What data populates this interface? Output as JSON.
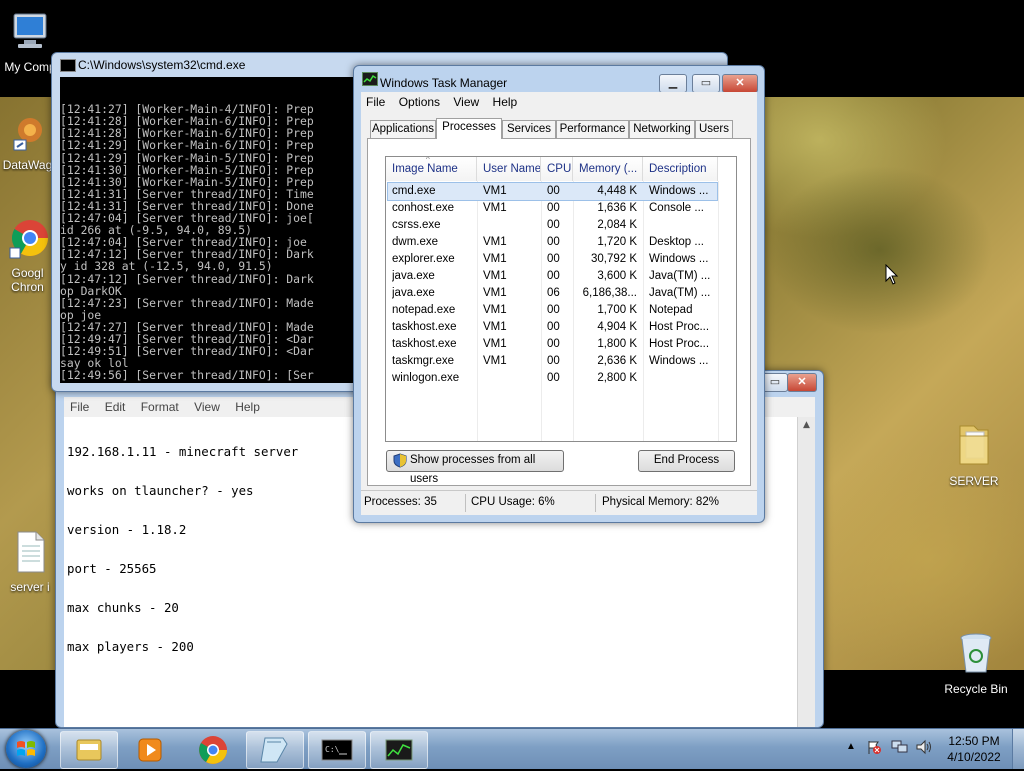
{
  "desktop": {
    "icons": {
      "my_computer": "My Comp",
      "datawag": "DataWag",
      "chrome_line1": "Googl",
      "chrome_line2": "Chron",
      "server_file": "server i",
      "server_folder": "SERVER",
      "recycle_bin": "Recycle Bin"
    }
  },
  "cmd": {
    "title": "C:\\Windows\\system32\\cmd.exe",
    "lines": [
      "[12:41:27] [Worker-Main-4/INFO]: Prep",
      "[12:41:28] [Worker-Main-6/INFO]: Prep",
      "[12:41:28] [Worker-Main-6/INFO]: Prep",
      "[12:41:29] [Worker-Main-6/INFO]: Prep",
      "[12:41:29] [Worker-Main-5/INFO]: Prep",
      "[12:41:30] [Worker-Main-5/INFO]: Prep",
      "[12:41:30] [Worker-Main-5/INFO]: Prep",
      "[12:41:31] [Server thread/INFO]: Time",
      "[12:41:31] [Server thread/INFO]: Done",
      "[12:47:04] [Server thread/INFO]: joe[",
      "id 266 at (-9.5, 94.0, 89.5)",
      "[12:47:04] [Server thread/INFO]: joe ",
      "[12:47:12] [Server thread/INFO]: Dark",
      "y id 328 at (-12.5, 94.0, 91.5)",
      "[12:47:12] [Server thread/INFO]: Dark",
      "op DarkOK",
      "[12:47:23] [Server thread/INFO]: Made",
      "op joe",
      "[12:47:27] [Server thread/INFO]: Made",
      "[12:49:47] [Server thread/INFO]: <Dar",
      "[12:49:51] [Server thread/INFO]: <Dar",
      "say ok lol",
      "[12:49:56] [Server thread/INFO]: [Ser"
    ]
  },
  "notepad": {
    "menu": [
      "File",
      "Edit",
      "Format",
      "View",
      "Help"
    ],
    "lines": [
      "192.168.1.11 - minecraft server",
      "works on tlauncher? - yes",
      "version - 1.18.2",
      "port - 25565",
      "max chunks - 20",
      "max players - 200"
    ]
  },
  "task_manager": {
    "title": "Windows Task Manager",
    "menu": [
      "File",
      "Options",
      "View",
      "Help"
    ],
    "tabs": [
      "Applications",
      "Processes",
      "Services",
      "Performance",
      "Networking",
      "Users"
    ],
    "columns": [
      "Image Name",
      "User Name",
      "CPU",
      "Memory (...",
      "Description"
    ],
    "rows": [
      {
        "name": "cmd.exe",
        "user": "VM1",
        "cpu": "00",
        "mem": "4,448 K",
        "desc": "Windows ..."
      },
      {
        "name": "conhost.exe",
        "user": "VM1",
        "cpu": "00",
        "mem": "1,636 K",
        "desc": "Console ..."
      },
      {
        "name": "csrss.exe",
        "user": "",
        "cpu": "00",
        "mem": "2,084 K",
        "desc": ""
      },
      {
        "name": "dwm.exe",
        "user": "VM1",
        "cpu": "00",
        "mem": "1,720 K",
        "desc": "Desktop ..."
      },
      {
        "name": "explorer.exe",
        "user": "VM1",
        "cpu": "00",
        "mem": "30,792 K",
        "desc": "Windows ..."
      },
      {
        "name": "java.exe",
        "user": "VM1",
        "cpu": "00",
        "mem": "3,600 K",
        "desc": "Java(TM) ..."
      },
      {
        "name": "java.exe",
        "user": "VM1",
        "cpu": "06",
        "mem": "6,186,38...",
        "desc": "Java(TM) ..."
      },
      {
        "name": "notepad.exe",
        "user": "VM1",
        "cpu": "00",
        "mem": "1,700 K",
        "desc": "Notepad"
      },
      {
        "name": "taskhost.exe",
        "user": "VM1",
        "cpu": "00",
        "mem": "4,904 K",
        "desc": "Host Proc..."
      },
      {
        "name": "taskhost.exe",
        "user": "VM1",
        "cpu": "00",
        "mem": "1,800 K",
        "desc": "Host Proc..."
      },
      {
        "name": "taskmgr.exe",
        "user": "VM1",
        "cpu": "00",
        "mem": "2,636 K",
        "desc": "Windows ..."
      },
      {
        "name": "winlogon.exe",
        "user": "",
        "cpu": "00",
        "mem": "2,800 K",
        "desc": ""
      }
    ],
    "show_all_button": "Show processes from all users",
    "end_process_button": "End Process",
    "status": {
      "processes": "Processes: 35",
      "cpu": "CPU Usage: 6%",
      "memory": "Physical Memory: 82%"
    }
  },
  "taskbar": {
    "time": "12:50 PM",
    "date": "4/10/2022"
  },
  "colors": {
    "selection": "#dbe8f8",
    "column_header_text": "#1e3287",
    "taskbar": "#7e9fc4"
  }
}
